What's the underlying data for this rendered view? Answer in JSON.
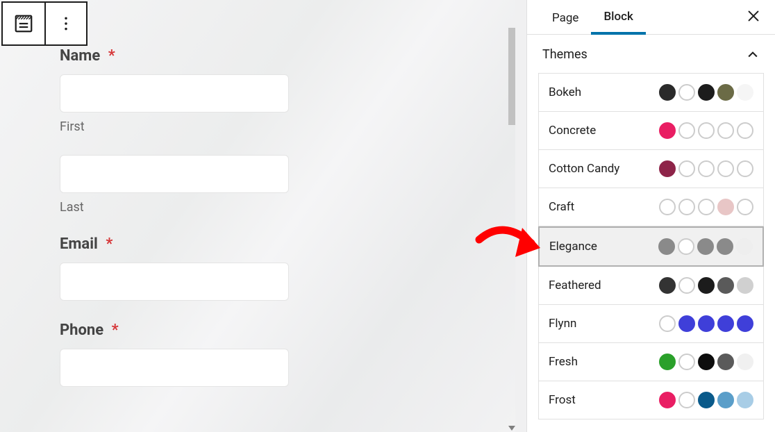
{
  "toolbar": {
    "block_icon": "form-block-icon",
    "options_icon": "more-options-icon"
  },
  "form": {
    "name": {
      "label": "Name",
      "required": "*",
      "sub_first": "First",
      "sub_last": "Last"
    },
    "email": {
      "label": "Email",
      "required": "*"
    },
    "phone": {
      "label": "Phone",
      "required": "*"
    }
  },
  "sidebar": {
    "tabs": {
      "page": "Page",
      "block": "Block"
    },
    "active_tab": "Block",
    "section_title": "Themes",
    "themes": [
      {
        "name": "Bokeh",
        "swatches": [
          "#2a2a2a",
          "#ffffff",
          "#1c1c1c",
          "#6b6b46",
          "#f5f5f5"
        ]
      },
      {
        "name": "Concrete",
        "swatches": [
          "#e91e63",
          "#ffffff",
          "#ffffff",
          "#ffffff",
          "#ffffff"
        ]
      },
      {
        "name": "Cotton Candy",
        "swatches": [
          "#8e2449",
          "#ffffff",
          "#ffffff",
          "#ffffff",
          "#ffffff"
        ]
      },
      {
        "name": "Craft",
        "swatches": [
          "#ffffff",
          "#ffffff",
          "#ffffff",
          "#e8c6c6",
          "#ffffff"
        ]
      },
      {
        "name": "Elegance",
        "selected": true,
        "swatches": [
          "#8a8a8a",
          "#ffffff",
          "#8a8a8a",
          "#8a8a8a",
          "#eeeeee"
        ]
      },
      {
        "name": "Feathered",
        "swatches": [
          "#333333",
          "#ffffff",
          "#1c1c1c",
          "#5a5a5a",
          "#d0d0d0"
        ]
      },
      {
        "name": "Flynn",
        "swatches": [
          "#ffffff",
          "#3f3fd9",
          "#3f3fd9",
          "#3f3fd9",
          "#3f3fd9"
        ]
      },
      {
        "name": "Fresh",
        "swatches": [
          "#2aa02a",
          "#ffffff",
          "#0d0d0d",
          "#5a5a5a",
          "#f0f0f0"
        ]
      },
      {
        "name": "Frost",
        "swatches": [
          "#e91e63",
          "#ffffff",
          "#0a5a8a",
          "#5a9ec9",
          "#a8cde6"
        ]
      }
    ]
  }
}
